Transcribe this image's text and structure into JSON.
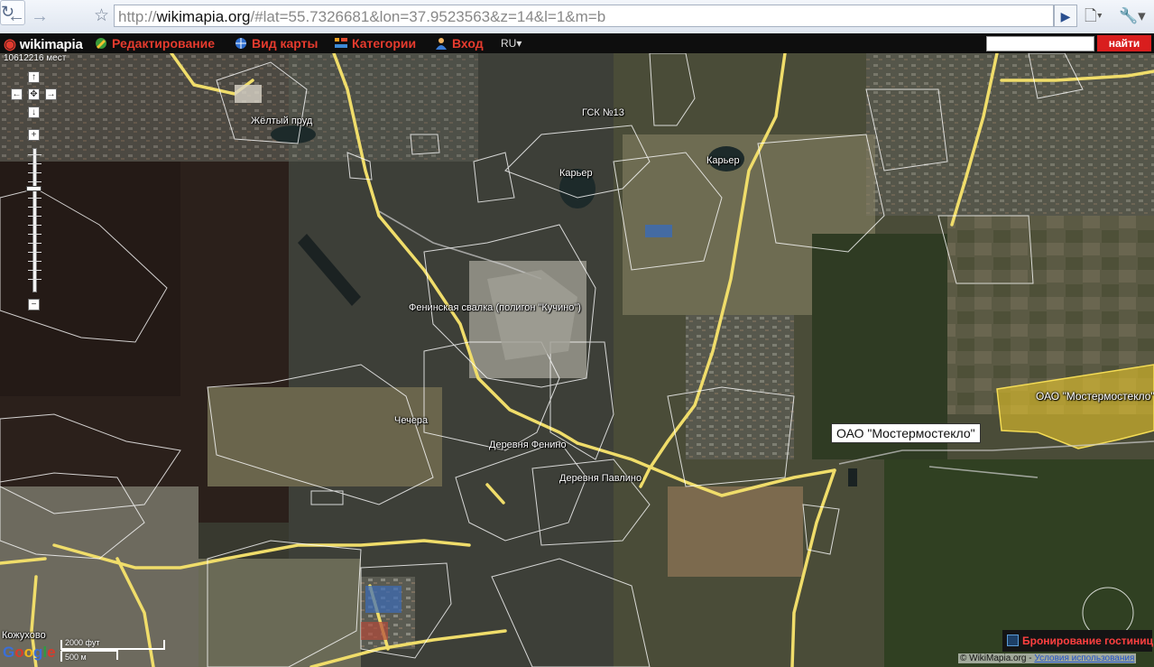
{
  "browser": {
    "url_prefix": "http://",
    "url_host": "wikimapia.org",
    "url_rest": "/#lat=55.7326681&lon=37.9523563&z=14&l=1&m=b",
    "back_icon": "arrow-left-icon",
    "forward_icon": "arrow-right-icon",
    "reload_icon": "reload-icon",
    "bookmark_icon": "star-icon",
    "go_icon": "play-icon",
    "page_icon": "page-menu-icon",
    "tools_icon": "wrench-icon"
  },
  "toolbar": {
    "logo": "wikimapia",
    "edit": "Редактирование",
    "map_view": "Вид карты",
    "categories": "Категории",
    "login": "Вход",
    "language": "RU",
    "search_value": "",
    "search_button": "найти"
  },
  "map": {
    "counter": "10612216 мест",
    "labels": {
      "yellow_pond": "Жёлтый пруд",
      "gsk13": "ГСК №13",
      "quarry1": "Карьер",
      "quarry2": "Карьер",
      "dump": "Фенинская свалка (полигон \"Кучино\")",
      "chechera": "Чечера",
      "fenino": "Деревня Фенино",
      "pavlino": "Деревня Павлино",
      "mostermosteklo_map": "ОАО \"Мостермостекло\"",
      "kozhukhovo": "Кожухово"
    },
    "selected_object": "ОАО \"Мостермостекло\""
  },
  "controls": {
    "pan_up": "↑",
    "pan_left": "←",
    "pan_center": "✥",
    "pan_right": "→",
    "pan_down": "↓",
    "zoom_in": "+",
    "zoom_out": "−"
  },
  "footer": {
    "booking": "Бронирование гостиниц",
    "copyright": "© WikiMapia.org - ",
    "terms": "Условия использования",
    "google": "Google",
    "scale_ft": "2000 фут",
    "scale_m": "500 м"
  },
  "colors": {
    "accent_red": "#e63b2e",
    "road_yellow": "#f0dd6a",
    "highlight_yellow": "#e8c42a"
  }
}
